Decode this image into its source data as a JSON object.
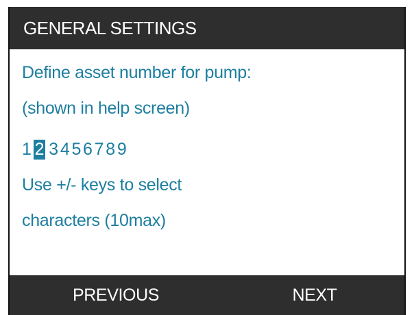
{
  "header": {
    "title": "GENERAL SETTINGS"
  },
  "prompt": {
    "line1": "Define asset number for pump:",
    "line2": "(shown in help screen)"
  },
  "asset_number": {
    "characters": [
      "1",
      "2",
      "3",
      "4",
      "5",
      "6",
      "7",
      "8",
      "9"
    ],
    "selected_index": 1
  },
  "instructions": {
    "line1": "Use +/- keys to select",
    "line2": "characters (10max)"
  },
  "softkeys": {
    "previous_label": "PREVIOUS",
    "next_label": "NEXT"
  },
  "colors": {
    "header_bg": "#2f2e2e",
    "text_accent": "#1d7ea0",
    "highlight_bg": "#1d7ea0"
  }
}
